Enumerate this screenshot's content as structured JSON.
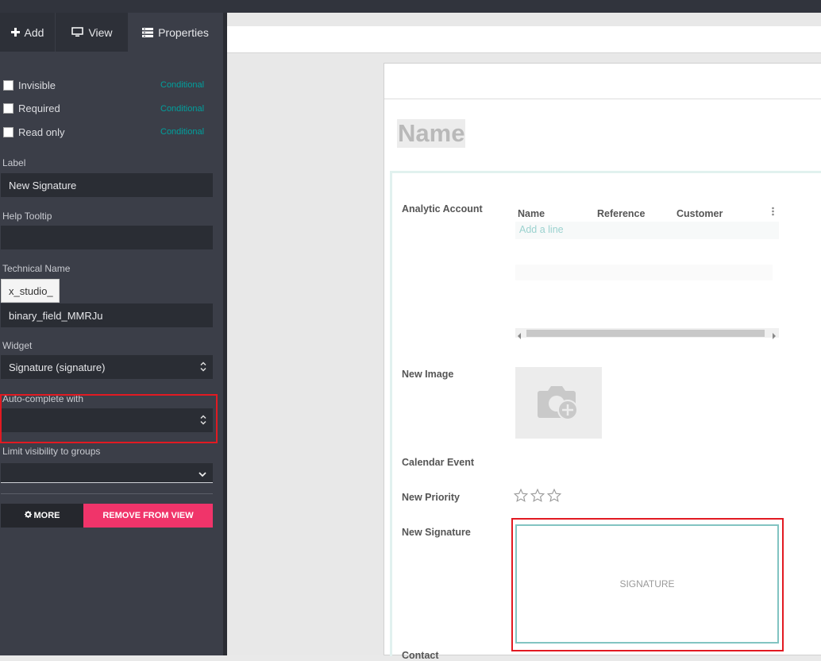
{
  "sidebar": {
    "tabs": [
      {
        "label": "Add",
        "icon": "plus-icon"
      },
      {
        "label": "View",
        "icon": "monitor-icon"
      },
      {
        "label": "Properties",
        "icon": "properties-icon"
      }
    ],
    "checkboxes": [
      {
        "label": "Invisible",
        "conditional": "Conditional",
        "checked": false
      },
      {
        "label": "Required",
        "conditional": "Conditional",
        "checked": false
      },
      {
        "label": "Read only",
        "conditional": "Conditional",
        "checked": false
      }
    ],
    "label_title": "Label",
    "label_value": "New Signature",
    "help_title": "Help Tooltip",
    "help_value": "",
    "technical_title": "Technical Name",
    "technical_prefix": "x_studio_",
    "technical_value": "binary_field_MMRJu",
    "widget_title": "Widget",
    "widget_value": "Signature (signature)",
    "autocomplete_title": "Auto-complete with",
    "autocomplete_value": "",
    "groups_title": "Limit visibility to groups",
    "groups_value": "",
    "more_label": "MORE",
    "remove_label": "REMOVE FROM VIEW"
  },
  "form": {
    "name_placeholder": "Name",
    "fields": {
      "analytic_account": "Analytic Account",
      "new_image": "New Image",
      "calendar_event": "Calendar Event",
      "new_priority": "New Priority",
      "new_signature": "New Signature",
      "contact": "Contact"
    },
    "table_headers": [
      "Name",
      "Reference",
      "Customer"
    ],
    "add_line": "Add a line",
    "signature_placeholder": "SIGNATURE",
    "priority_stars": 3
  },
  "colors": {
    "accent": "#00a09d",
    "remove": "#f0346a",
    "highlight": "#e21a22"
  }
}
